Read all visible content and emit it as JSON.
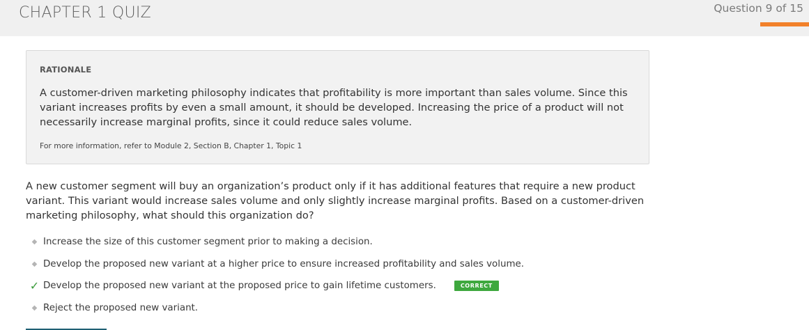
{
  "header": {
    "title": "CHAPTER 1 QUIZ",
    "question_counter": "Question 9 of 15",
    "progress_color": "#f2812a"
  },
  "rationale": {
    "heading": "RATIONALE",
    "body": "A customer-driven marketing philosophy indicates that profitability is more important than sales volume. Since this variant increases profits by even a small amount, it should be developed. Increasing the price of a product will not necessarily increase marginal profits, since it could reduce sales volume.",
    "reference": "For more information, refer to Module 2, Section B, Chapter 1, Topic 1"
  },
  "question": {
    "text": "A new customer segment will buy an organization’s product only if it has additional features that require a new product variant. This variant would increase sales volume and only slightly increase marginal profits. Based on a customer-driven marketing philosophy, what should this organization do?"
  },
  "options": [
    {
      "label": "Increase the size of this customer segment prior to making a decision.",
      "marker": "◆",
      "marker_icon": "diamond-bullet-icon"
    },
    {
      "label": "Develop the proposed new variant at a higher price to ensure increased profitability and sales volume.",
      "marker": "◆",
      "marker_icon": "diamond-bullet-icon"
    },
    {
      "label": "Develop the proposed new variant at the proposed price to gain lifetime customers.",
      "marker": "✓",
      "marker_icon": "checkmark-icon",
      "badge": "CORRECT"
    },
    {
      "label": "Reject the proposed new variant.",
      "marker": "◆",
      "marker_icon": "diamond-bullet-icon"
    }
  ],
  "colors": {
    "correct": "#3ea83e",
    "check": "#3a9a3a",
    "accent": "#f2812a"
  }
}
